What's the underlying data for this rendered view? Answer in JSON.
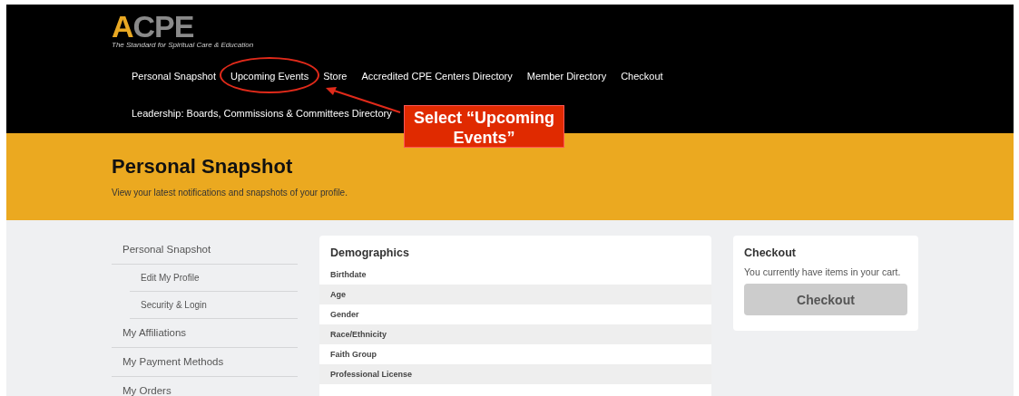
{
  "logo": {
    "text": "ACPE",
    "tagline": "The Standard for Spiritual Care & Education"
  },
  "nav": {
    "rows": [
      [
        {
          "label": "Personal Snapshot",
          "highlighted": false
        },
        {
          "label": "Upcoming Events",
          "highlighted": true
        },
        {
          "label": "Store",
          "highlighted": false
        },
        {
          "label": "Accredited CPE Centers Directory",
          "highlighted": false
        },
        {
          "label": "Member Directory",
          "highlighted": false
        },
        {
          "label": "Checkout",
          "highlighted": false
        }
      ],
      [
        {
          "label": "Leadership: Boards, Commissions & Committees Directory",
          "highlighted": false
        }
      ]
    ]
  },
  "annotation": {
    "label": "Select “Upcoming Events”"
  },
  "banner": {
    "title": "Personal Snapshot",
    "subtitle": "View your latest notifications and snapshots of your profile."
  },
  "sidebar": {
    "items": [
      {
        "label": "Personal Snapshot",
        "children": [
          {
            "label": "Edit My Profile"
          },
          {
            "label": "Security & Login"
          }
        ]
      },
      {
        "label": "My Affiliations"
      },
      {
        "label": "My Payment Methods"
      },
      {
        "label": "My Orders"
      }
    ]
  },
  "demographics": {
    "title": "Demographics",
    "rows": [
      {
        "label": "Birthdate"
      },
      {
        "label": "Age"
      },
      {
        "label": "Gender"
      },
      {
        "label": "Race/Ethnicity"
      },
      {
        "label": "Faith Group"
      },
      {
        "label": "Professional License"
      }
    ]
  },
  "checkout": {
    "title": "Checkout",
    "text": "You currently have items in your cart.",
    "button": "Checkout"
  }
}
